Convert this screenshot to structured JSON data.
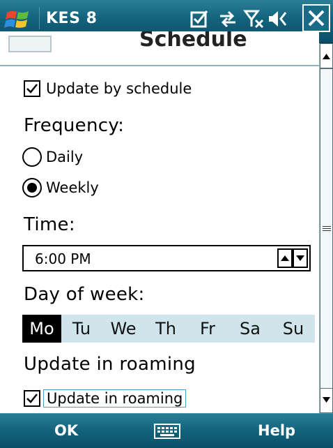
{
  "titlebar": {
    "app_title": "KES 8",
    "icons": [
      "windows-start-icon",
      "notification-icon",
      "connectivity-icon",
      "signal-icon",
      "volume-icon",
      "close-icon"
    ]
  },
  "heading": {
    "title": "Schedule",
    "icon": "calendar-icon"
  },
  "update_by_schedule": {
    "label": "Update by schedule",
    "checked": true
  },
  "frequency": {
    "title": "Frequency:",
    "options": [
      {
        "label": "Daily",
        "selected": false
      },
      {
        "label": "Weekly",
        "selected": true
      }
    ]
  },
  "time": {
    "title": "Time:",
    "value": "6:00 PM"
  },
  "day_of_week": {
    "title": "Day of week:",
    "days": [
      "Mo",
      "Tu",
      "We",
      "Th",
      "Fr",
      "Sa",
      "Su"
    ],
    "selected": "Mo"
  },
  "roaming": {
    "title": "Update in roaming",
    "checkbox_label": "Update in roaming",
    "checked": true
  },
  "softkeys": {
    "left": "OK",
    "right": "Help",
    "center_icon": "keyboard-icon"
  },
  "colors": {
    "bar_teal": "#13627c",
    "day_strip": "#cfe5eb",
    "selected_day_bg": "#000000"
  }
}
